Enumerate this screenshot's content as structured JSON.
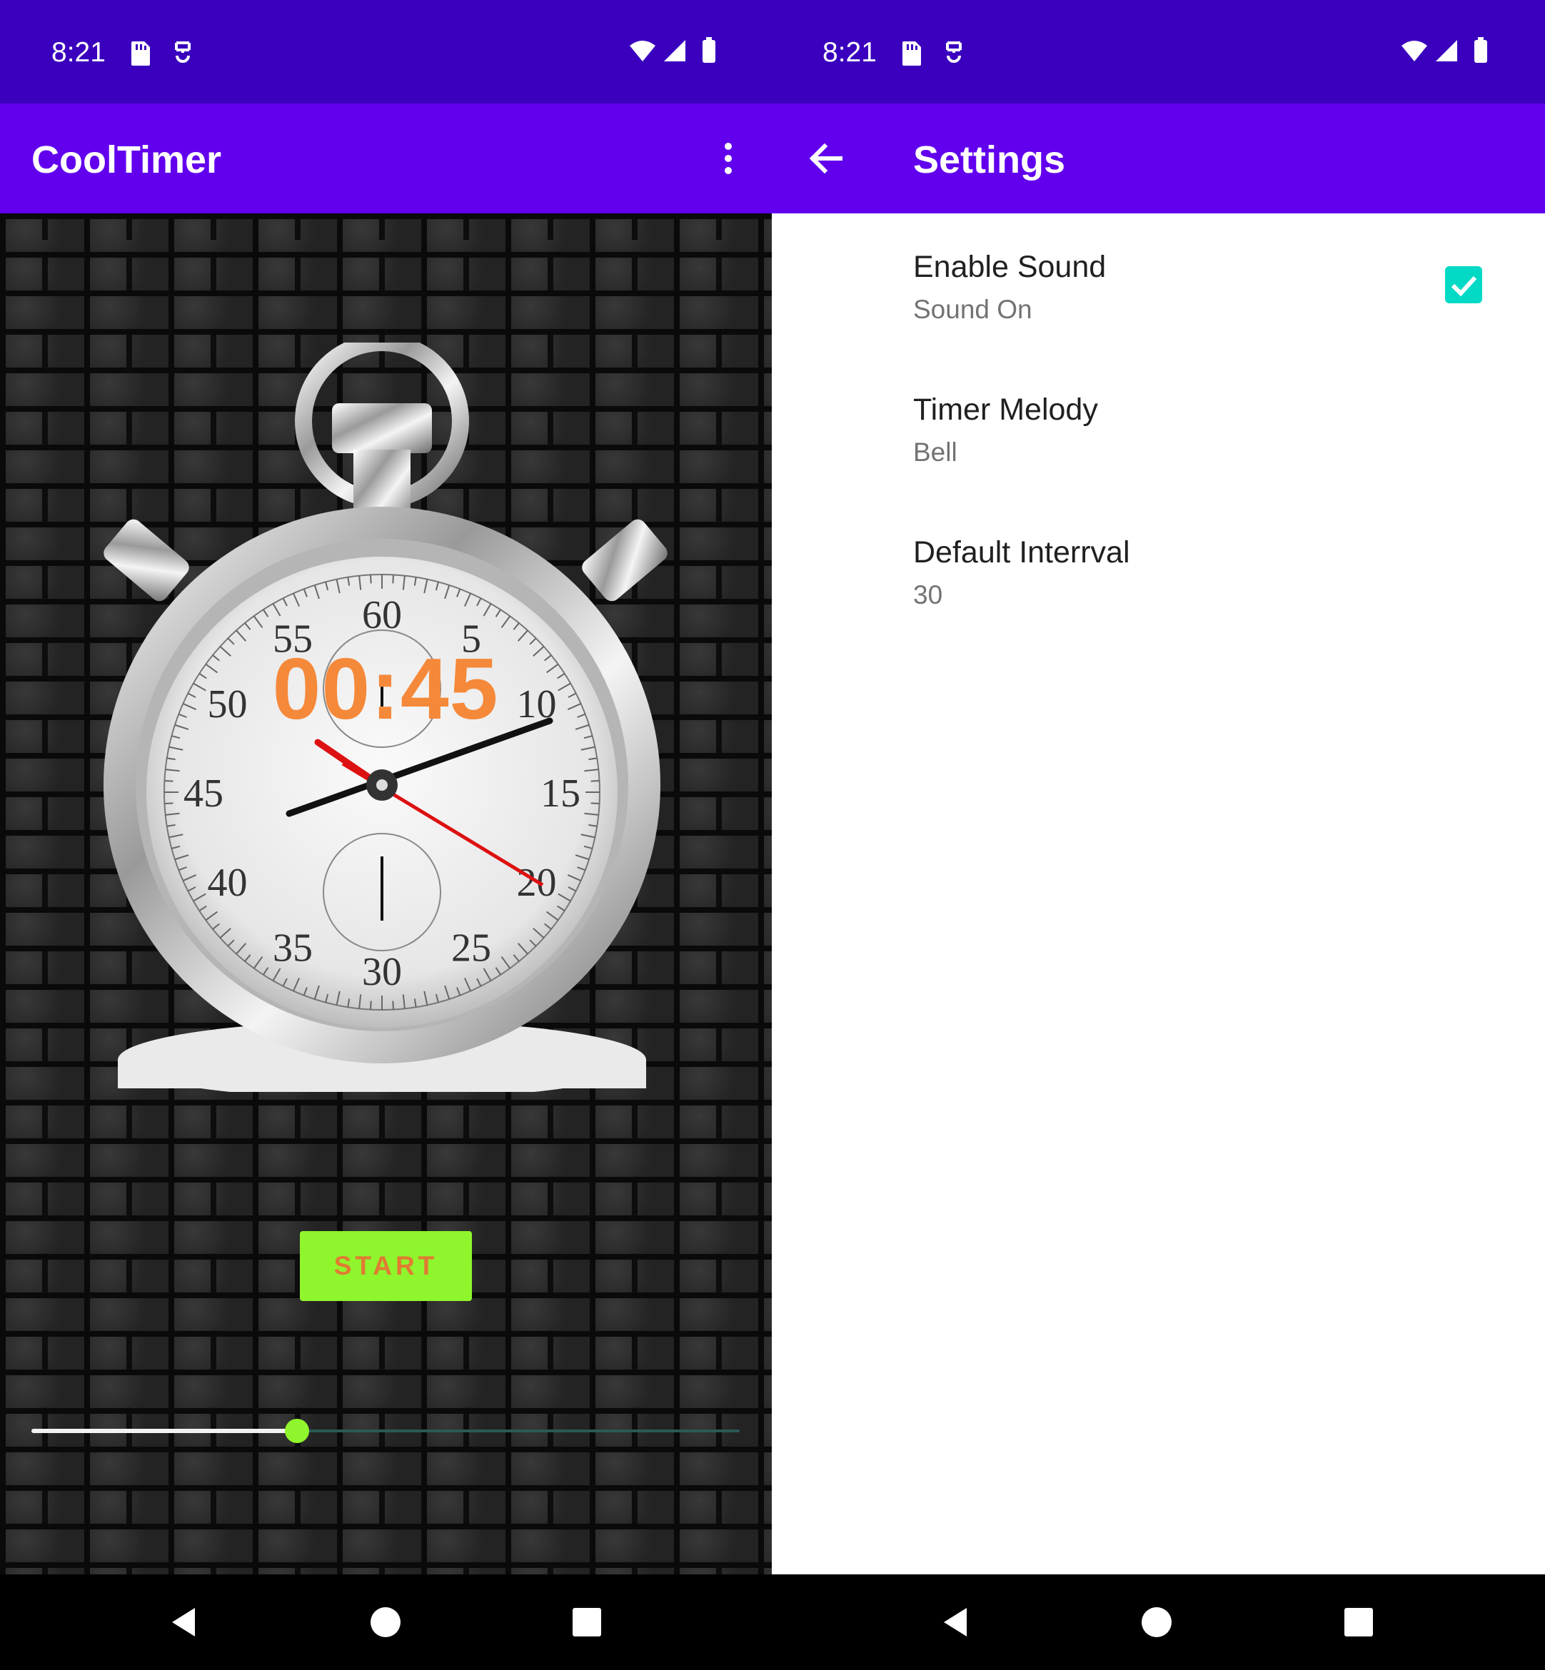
{
  "left": {
    "status_bar": {
      "time": "8:21"
    },
    "app_bar": {
      "title": "CoolTimer",
      "menu_icon": "more-vert-icon"
    },
    "timer": {
      "display": "00:45"
    },
    "start_button": {
      "label": "START"
    },
    "slider": {
      "fraction": 0.375
    },
    "stopwatch_dial": {
      "numbers": [
        "60",
        "5",
        "10",
        "15",
        "20",
        "25",
        "30",
        "35",
        "40",
        "45",
        "50",
        "55"
      ]
    },
    "colors": {
      "timer_text": "#f5893a",
      "start_bg": "#8ff52c",
      "start_text": "#e07b32",
      "thumb": "#8ff52c"
    }
  },
  "right": {
    "status_bar": {
      "time": "8:21"
    },
    "app_bar": {
      "title": "Settings",
      "back_icon": "arrow-back-icon"
    },
    "preferences": [
      {
        "title": "Enable Sound",
        "summary": "Sound On",
        "checked": true
      },
      {
        "title": "Timer Melody",
        "summary": "Bell"
      },
      {
        "title": "Default Interrval",
        "summary": "30"
      }
    ],
    "colors": {
      "checkbox": "#03dac5",
      "app_bar": "#6200ee",
      "status_bar": "#3a00bd"
    }
  }
}
